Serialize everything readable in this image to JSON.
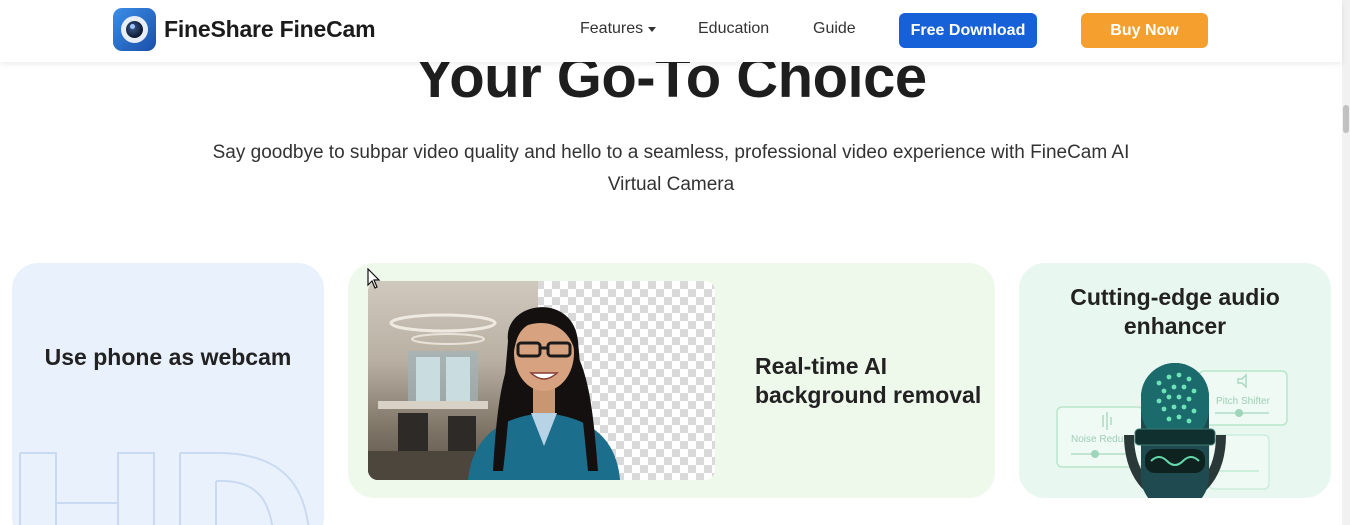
{
  "header": {
    "brand": "FineShare FineCam",
    "nav": {
      "features": "Features",
      "education": "Education",
      "guide": "Guide"
    },
    "free_download": "Free Download",
    "buy_now": "Buy Now"
  },
  "hero": {
    "title": "Your Go-To Choice",
    "subtitle_line1": "Say goodbye to subpar video quality and hello to a seamless, professional video experience with FineCam AI",
    "subtitle_line2": "Virtual Camera"
  },
  "cards": {
    "phone": {
      "title": "Use phone as webcam",
      "deco": "HD"
    },
    "background": {
      "title_line1": "Real-time AI",
      "title_line2": "background removal"
    },
    "audio": {
      "title_line1": "Cutting-edge audio",
      "title_line2": "enhancer",
      "panel_pitch": "Pitch Shifter",
      "panel_noise": "Noise Redu"
    }
  },
  "colors": {
    "free_download_bg": "#1761d8",
    "buy_now_bg": "#f5a02e",
    "phone_card_bg": "#e9f1fc",
    "bg_card_bg": "#eef9ec",
    "audio_card_bg": "#e8f7ef"
  }
}
